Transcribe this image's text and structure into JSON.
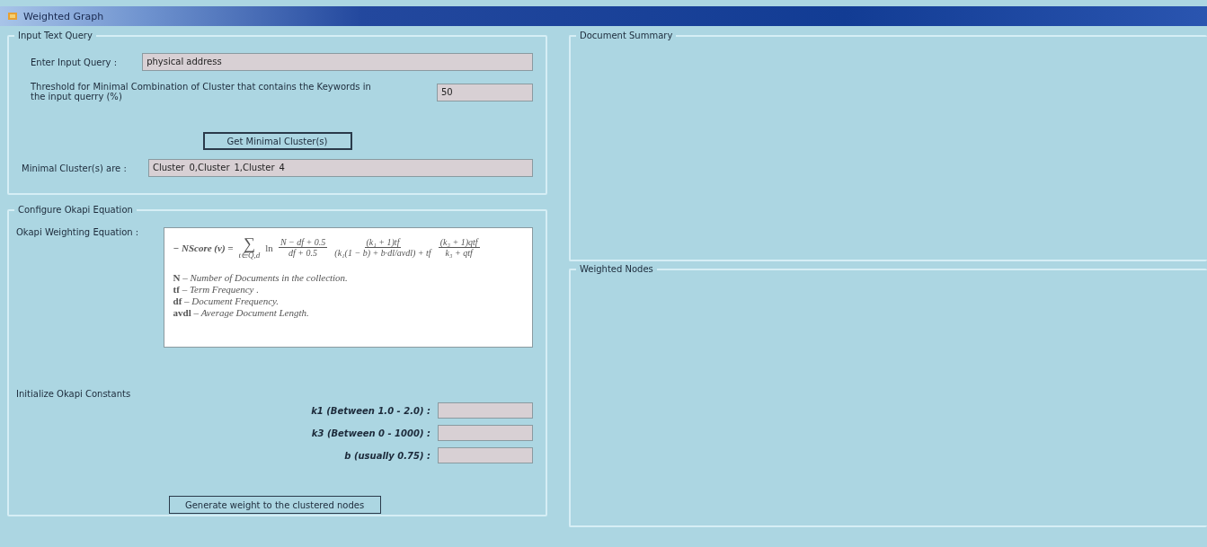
{
  "window": {
    "title": "Weighted Graph"
  },
  "input_group": {
    "title": "Input Text Query",
    "query_label": "Enter Input Query :",
    "query_value": "physical address",
    "threshold_label": "Threshold for Minimal Combination of Cluster that contains the Keywords in the input querry (%)",
    "threshold_value": "50",
    "button": "Get Minimal Cluster(s)",
    "result_label": "Minimal Cluster(s) are :",
    "result_value": "Cluster_0,Cluster_1,Cluster_4"
  },
  "okapi_group": {
    "title": "Configure Okapi Equation",
    "equation_label": "Okapi Weighting Equation :",
    "equation": {
      "lhs": "− NScore (v) =",
      "sum": "∑",
      "sum_sub": "t∈Q,d",
      "ln": "ln",
      "fractions": [
        {
          "num": "N − df + 0.5",
          "den": "df + 0.5"
        },
        {
          "num": "(k₁ + 1)tf",
          "den": "(k₁(1 − b) + b·dl/avdl) + tf"
        },
        {
          "num": "(k₃ + 1)qtf",
          "den": "k₃ + qtf"
        }
      ],
      "legend": [
        "**N** – *Number of Documents in the collection.*",
        "**tf** – *Term Frequency .*",
        "**df** – *Document Frequency.*",
        "**avdl** – *Average Document Length.*"
      ]
    },
    "constants_label": "Initialize Okapi Constants",
    "constants": [
      {
        "label": "k1 (Between 1.0 - 2.0) :"
      },
      {
        "label": "k3 (Between 0 - 1000) :"
      },
      {
        "label": "b (usually 0.75) :"
      }
    ],
    "button": "Generate weight to the clustered nodes"
  },
  "summary_group": {
    "title": "Document Summary"
  },
  "nodes_group": {
    "title": "Weighted Nodes"
  }
}
